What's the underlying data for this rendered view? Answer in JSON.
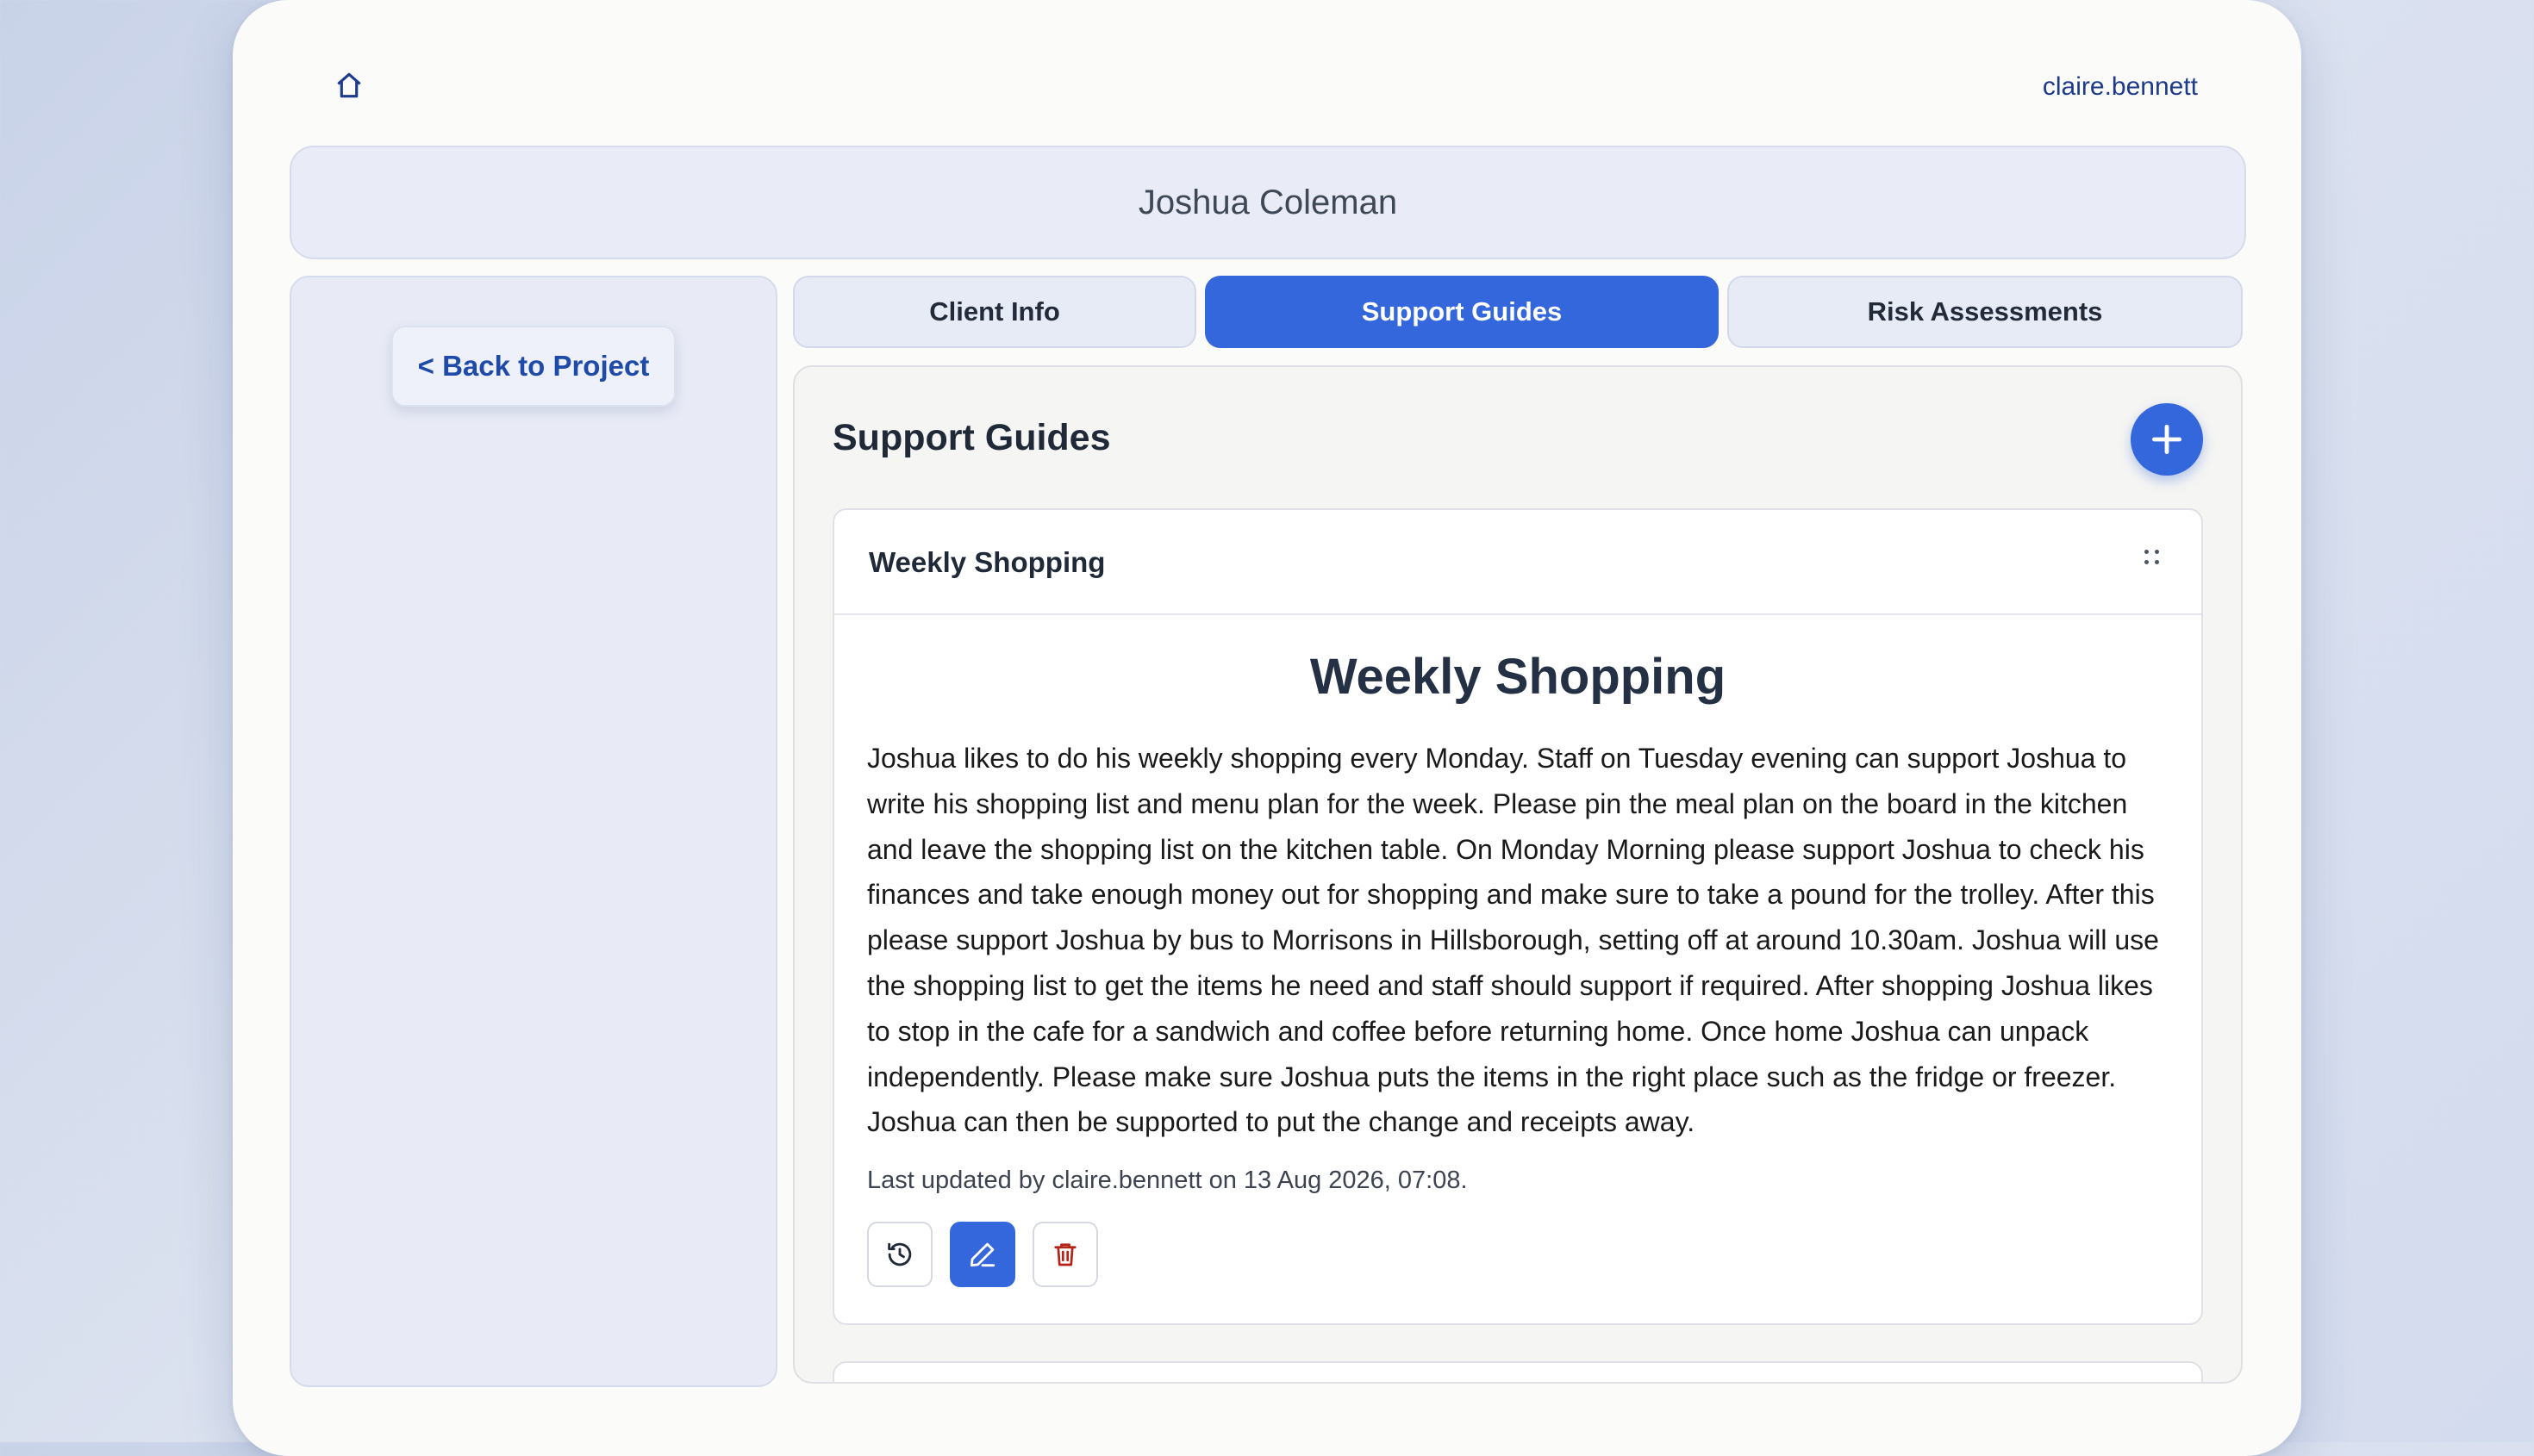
{
  "header": {
    "home_icon": "home-icon",
    "username": "claire.bennett"
  },
  "client": {
    "name": "Joshua Coleman"
  },
  "sidebar": {
    "back_label": "< Back to Project"
  },
  "tabs": [
    {
      "label": "Client Info",
      "active": false
    },
    {
      "label": "Support Guides",
      "active": true
    },
    {
      "label": "Risk Assessments",
      "active": false
    }
  ],
  "panel": {
    "title": "Support Guides",
    "add_icon": "plus-icon"
  },
  "guide": {
    "header_title": "Weekly Shopping",
    "heading": "Weekly Shopping",
    "body": "Joshua likes to do his weekly shopping every Monday. Staff on Tuesday evening can support Joshua to write his shopping list and menu plan for the week. Please pin the meal plan on the board in the kitchen and leave the shopping list on the kitchen table. On Monday Morning please support Joshua to check his finances and take enough money out for shopping and make sure to take a pound for the trolley. After this please support Joshua by bus to Morrisons in Hillsborough, setting off at around 10.30am. Joshua will use the shopping list to get the items he need and staff should support if required. After shopping Joshua likes to stop in the cafe for a sandwich and coffee before returning home. Once home Joshua can unpack independently. Please make sure Joshua puts the items in the right place such as the fridge or freezer. Joshua can then be supported to put the change and receipts away.",
    "last_updated": "Last updated by claire.bennett on 13 Aug 2026, 07:08.",
    "actions": [
      "history-icon",
      "edit-icon",
      "delete-icon"
    ]
  },
  "colors": {
    "accent": "#3467db",
    "link": "#1e4aa8",
    "danger": "#b42318"
  }
}
